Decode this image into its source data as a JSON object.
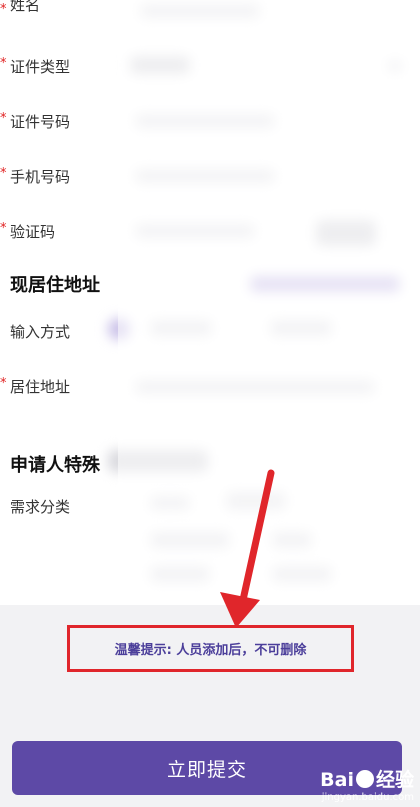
{
  "form": {
    "name_label": "姓名",
    "id_type_label": "证件类型",
    "id_number_label": "证件号码",
    "phone_label": "手机号码",
    "code_label": "验证码",
    "address_section_title": "现居住地址",
    "input_method_label": "输入方式",
    "residence_address_label": "居住地址",
    "special_section_title": "申请人特殊",
    "needs_category_label": "需求分类",
    "required_mark": "*"
  },
  "tip": {
    "text": "温馨提示: 人员添加后，不可删除"
  },
  "submit": {
    "label": "立即提交"
  },
  "watermark": {
    "brand_left": "Bai",
    "brand_right": "经验",
    "url": "jingyan.baidu.com"
  },
  "colors": {
    "accent": "#5d49a6",
    "highlight_border": "#e0262b",
    "tip_text": "#4b3e9a",
    "required": "#e02020"
  }
}
